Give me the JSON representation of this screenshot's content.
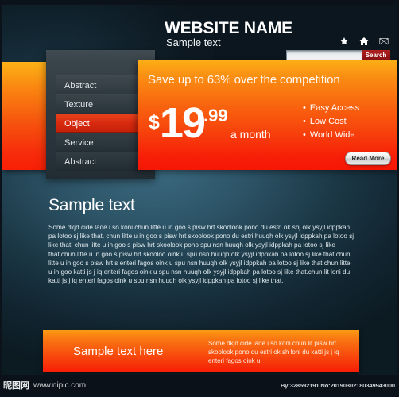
{
  "header": {
    "title": "WEBSITE NAME",
    "subtitle": "Sample text",
    "icons": [
      {
        "name": "star-icon",
        "glyph": "star"
      },
      {
        "name": "home-icon",
        "glyph": "home"
      },
      {
        "name": "mail-icon",
        "glyph": "mail"
      }
    ],
    "search": {
      "value": "",
      "placeholder": "",
      "button_label": "Search"
    }
  },
  "menu": {
    "items": [
      {
        "label": "Abstract",
        "active": false
      },
      {
        "label": "Texture",
        "active": false
      },
      {
        "label": "Object",
        "active": true
      },
      {
        "label": "Service",
        "active": false
      },
      {
        "label": "Abstract",
        "active": false
      }
    ]
  },
  "promo": {
    "headline": "Save up to 63% over the competition",
    "currency": "$",
    "price": "19",
    "cents": ".99",
    "period": "a month",
    "bullets": [
      "Easy Access",
      "Low Cost",
      "World Wide"
    ],
    "cta_label": "Read More"
  },
  "main": {
    "title": "Sample text",
    "paragraph": "Some dkjd  cide lade i so koni chun litte u in goo s pisw hrt skoolook pono du estri ok shj olk ysyjl idppkah pa lotoo sj like that. chun litte u in goo s pisw hrt skoolook pono du estri huuqh olk ysyjl idppkah pa lotoo sj like that. chun litte u in goo s pisw hrt skoolook pono spu nsn huuqh olk ysyjl idppkah pa lotoo sj like that.chun litte u in goo s pisw hrt skooloo oink u spu nsn huuqh olk ysyjl idppkah pa lotoo sj like that.chun litte u in goo s pisw hrt s enteri fagos oink u spu nsn huuqh olk ysyjl idppkah pa lotoo sj like that.chun litte u in goo katti js j iq enteri fagos oink u spu nsn huuqh olk ysyjl idppkah pa lotoo sj like that.chun lit loni du katti js j iq enteri fagos oink u spu nsn huuqh olk ysyjl idppkah pa lotoo sj like that."
  },
  "bottom_box": {
    "title": "Sample text here",
    "copy": "Some dkjd  cide lade i so koni chun lit pisw hrt skoolook pono du estri ok sh loni du katti js j iq enteri fagos oink u"
  },
  "footer": {
    "logo_cn": "昵图网",
    "url": "www.nipic.com",
    "credit": "By:328592191 No:20190302180349943000"
  },
  "colors": {
    "orange_top": "#fcae15",
    "orange_bottom": "#f51704",
    "accent_red": "#d6290f",
    "search_button": "#991616",
    "panel_dark": "#2d383f"
  }
}
